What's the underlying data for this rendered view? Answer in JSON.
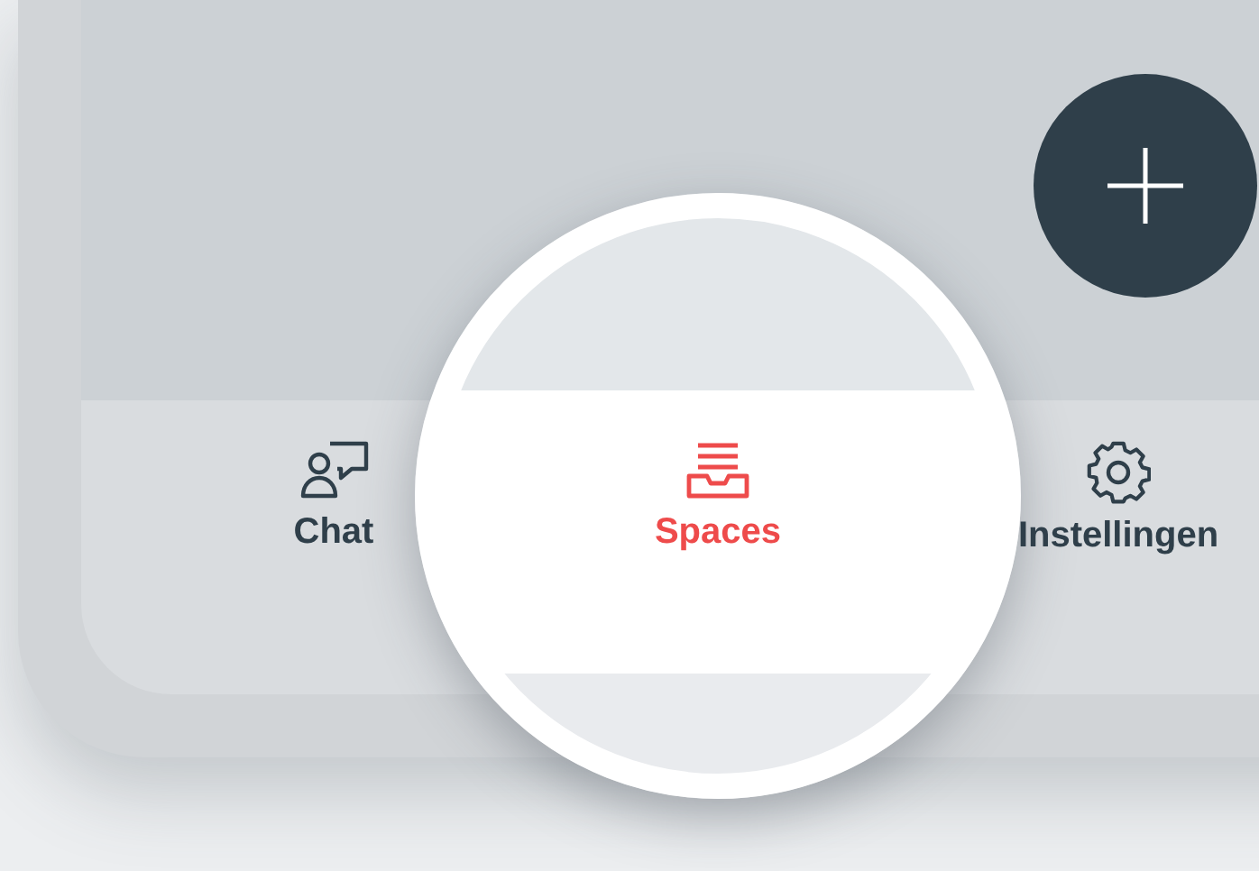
{
  "tabs": [
    {
      "kind": "chat",
      "label": "Chat",
      "selected": false
    },
    {
      "kind": "spaces",
      "label": "Spaces",
      "selected": true
    },
    {
      "kind": "settings",
      "label": "Instellingen",
      "selected": false
    }
  ]
}
